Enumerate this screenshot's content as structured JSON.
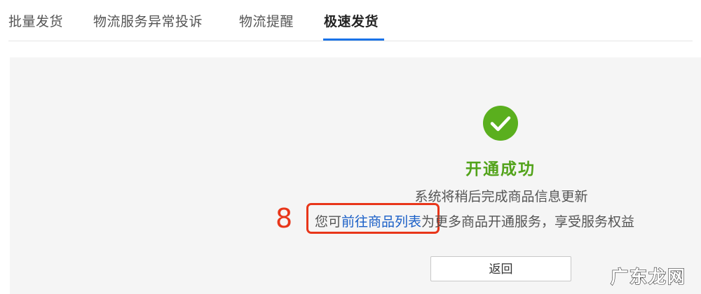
{
  "tabs": [
    {
      "label": "批量发货",
      "active": false
    },
    {
      "label": "物流服务异常投诉",
      "active": false
    },
    {
      "label": "物流提醒",
      "active": false
    },
    {
      "label": "极速发货",
      "active": true
    }
  ],
  "result": {
    "icon": "check-circle-icon",
    "title": "开通成功",
    "line1": "系统将稍后完成商品信息更新",
    "line2_prefix": "您可",
    "line2_link": "前往商品列表",
    "line2_suffix": "为更多商品开通服务，享受服务权益"
  },
  "annotation": {
    "step": "8"
  },
  "back_button": {
    "label": "返回"
  },
  "watermark": {
    "text": "广东龙网"
  },
  "colors": {
    "accent": "#1a73e8",
    "success": "#52a31a",
    "link": "#1a5fc7",
    "annotation": "#e8361a",
    "panel_bg": "#f5f5f5"
  }
}
